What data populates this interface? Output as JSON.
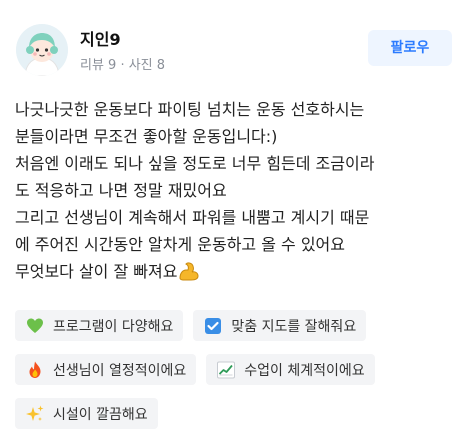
{
  "user": {
    "name": "지인9",
    "meta": "리뷰 9 · 사진 8",
    "follow_label": "팔로우"
  },
  "review": {
    "lines": [
      "나긋나긋한 운동보다 파이팅 넘치는 운동 선호하시는",
      "분들이라면 무조건 좋아할 운동입니다:)",
      "처음엔 이래도 되나 싶을 정도로 너무 힘든데 조금이라",
      "도 적응하고 나면 정말 재밌어요",
      "그리고 선생님이 계속해서 파워를 내뿜고 계시기 때문",
      "에 주어진 시간동안 알차게 운동하고 올 수 있어요",
      "무엇보다 살이 잘 빠져요"
    ]
  },
  "tags": [
    {
      "label": "프로그램이 다양해요",
      "icon": "green-heart-icon"
    },
    {
      "label": "맞춤 지도를 잘해줘요",
      "icon": "check-box-icon"
    },
    {
      "label": "선생님이 열정적이에요",
      "icon": "fire-icon"
    },
    {
      "label": "수업이 체계적이에요",
      "icon": "chart-increasing-icon"
    },
    {
      "label": "시설이 깔끔해요",
      "icon": "sparkles-icon"
    }
  ]
}
